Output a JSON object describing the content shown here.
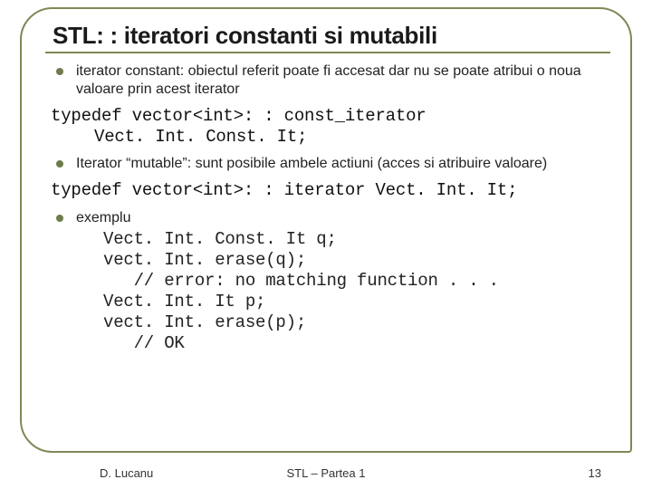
{
  "title": "STL: : iteratori constanti si mutabili",
  "bullets": {
    "b1": "iterator constant: obiectul referit poate fi accesat dar nu se poate atribui o noua valoare prin acest iterator",
    "b2": "Iterator “mutable”: sunt posibile ambele actiuni (acces si atribuire valoare)",
    "b3_label": "exemplu"
  },
  "code": {
    "typedef1_l1": "typedef vector<int>: : const_iterator",
    "typedef1_l2": "Vect. Int. Const. It;",
    "typedef2": "typedef vector<int>: : iterator Vect. Int. It;",
    "ex_l1": "Vect. Int. Const. It q;",
    "ex_l2": "vect. Int. erase(q);",
    "ex_l3": "   // error: no matching function . . .",
    "ex_l4": "Vect. Int. It p;",
    "ex_l5": "vect. Int. erase(p);",
    "ex_l6": "   // OK"
  },
  "footer": {
    "left": "D. Lucanu",
    "center": "STL – Partea 1",
    "right": "13"
  }
}
